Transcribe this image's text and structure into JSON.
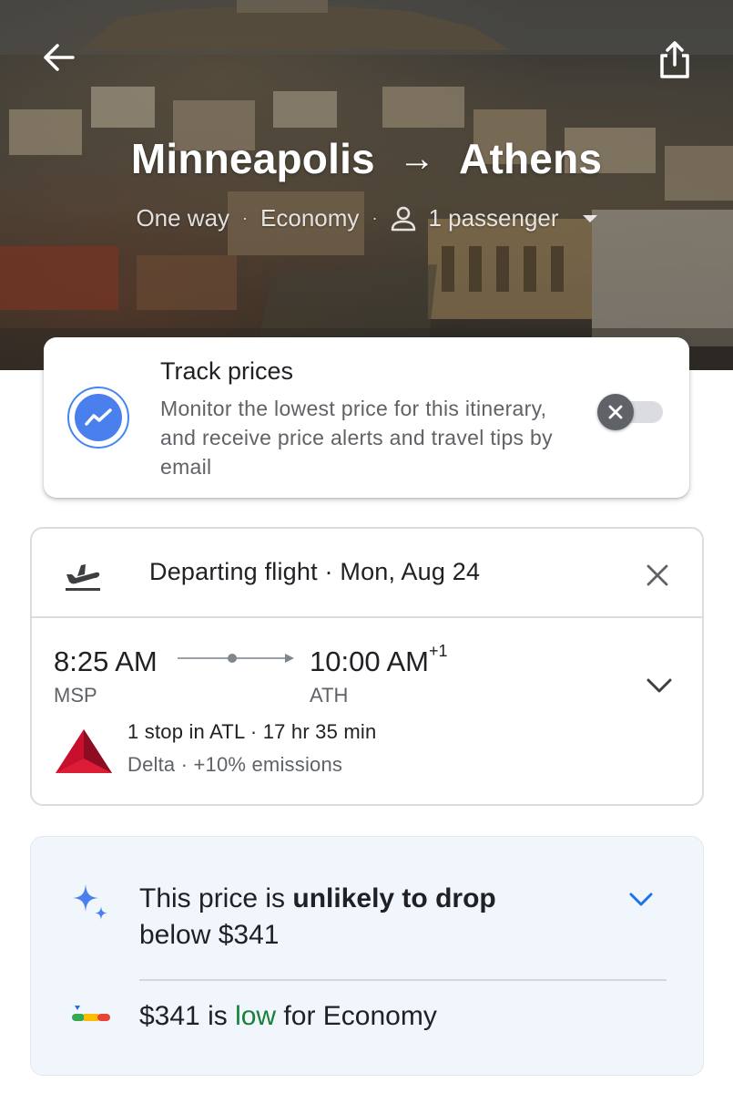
{
  "header": {
    "origin": "Minneapolis",
    "destination": "Athens",
    "arrow": "→",
    "trip_type": "One way",
    "cabin": "Economy",
    "passengers": "1 passenger",
    "back_icon": "arrow-back-icon",
    "share_icon": "share-icon"
  },
  "track_prices": {
    "title": "Track prices",
    "description": "Monitor the lowest price for this itinerary, and receive price alerts and travel tips by email",
    "enabled": false,
    "icon": "trending-icon"
  },
  "flight": {
    "heading": "Departing flight · Mon, Aug 24",
    "depart_time": "8:25 AM",
    "depart_code": "MSP",
    "arrive_time": "10:00 AM",
    "arrive_day_offset": "+1",
    "arrive_code": "ATH",
    "stops": "1 stop in ATL · 17 hr 35 min",
    "carrier": "Delta · +10% emissions"
  },
  "price_insight": {
    "prefix": "This price is ",
    "emphasis": "unlikely to drop",
    "suffix": "below $341",
    "low_price": "$341 is ",
    "low_word": "low",
    "low_suffix": " for Economy"
  },
  "colors": {
    "accent_blue": "#1a73e8",
    "low_green": "#188038",
    "delta_red": "#c8102e"
  }
}
